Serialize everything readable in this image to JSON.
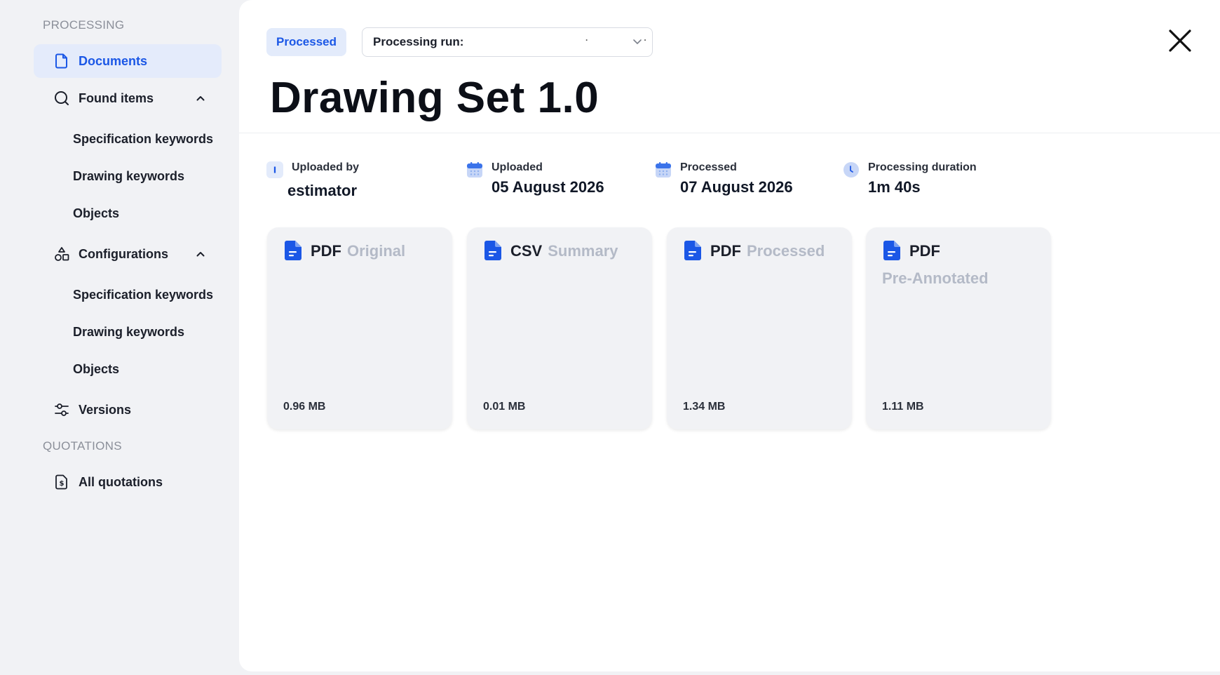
{
  "sidebar": {
    "processing_title": "PROCESSING",
    "documents": "Documents",
    "found_items": "Found items",
    "found_sub": [
      "Specification keywords",
      "Drawing keywords",
      "Objects"
    ],
    "configurations": "Configurations",
    "config_sub": [
      "Specification keywords",
      "Drawing keywords",
      "Objects"
    ],
    "versions": "Versions",
    "quotations_title": "QUOTATIONS",
    "all_quotations": "All quotations"
  },
  "header": {
    "status": "Processed",
    "run_label": "Processing run:",
    "title": "Drawing Set 1.0"
  },
  "meta": {
    "uploaded_by_label": "Uploaded by",
    "uploaded_by_icon_letter": "I",
    "uploaded_by_value": "estimator",
    "uploaded_label": "Uploaded",
    "uploaded_value": "05 August 2026",
    "processed_label": "Processed",
    "processed_value": "07 August 2026",
    "duration_label": "Processing duration",
    "duration_value": "1m 40s"
  },
  "files": [
    {
      "type": "PDF",
      "subtitle": "Original",
      "size": "0.96 MB"
    },
    {
      "type": "CSV",
      "subtitle": "Summary",
      "size": "0.01 MB"
    },
    {
      "type": "PDF",
      "subtitle": "Processed",
      "size": "1.34 MB"
    },
    {
      "type": "PDF",
      "subtitle": "Pre-Annotated",
      "size": "1.11 MB"
    }
  ],
  "colors": {
    "accent": "#1b57e6",
    "accent_bg": "#e3ebfb",
    "sidebar_bg": "#f1f2f5",
    "muted": "#b4bac7"
  }
}
